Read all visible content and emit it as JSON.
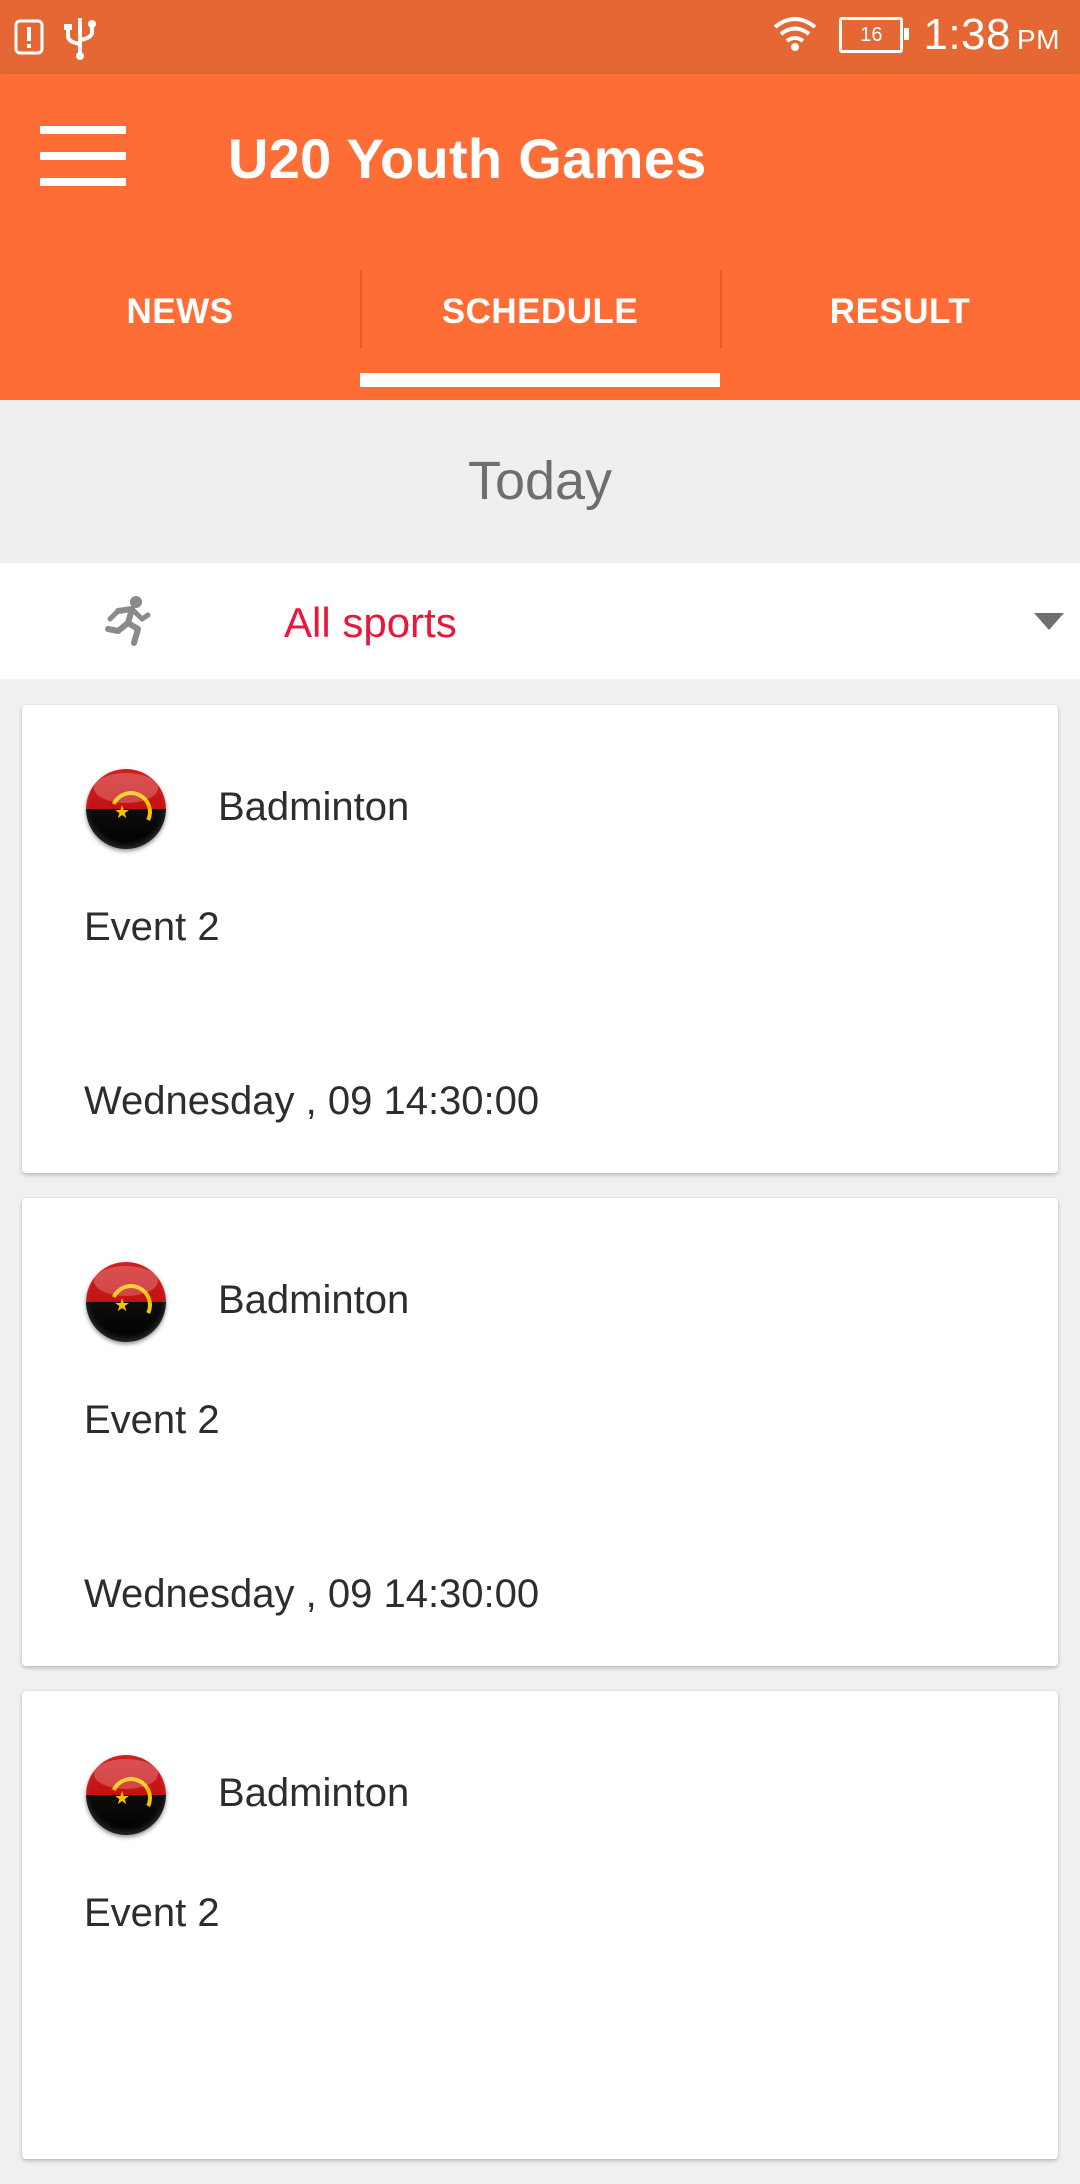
{
  "status_bar": {
    "time": "1:38",
    "ampm": "PM",
    "battery_level": "16",
    "icons": [
      "alert-icon",
      "usb-icon",
      "wifi-icon",
      "battery-icon"
    ]
  },
  "app_bar": {
    "title": "U20 Youth Games",
    "background": "#ff6d36",
    "tabs": [
      {
        "label": "NEWS",
        "active": false
      },
      {
        "label": "SCHEDULE",
        "active": true
      },
      {
        "label": "RESULT",
        "active": false
      }
    ]
  },
  "date_header": "Today",
  "filter": {
    "label": "All sports",
    "color": "#e8173b",
    "icon": "running-icon"
  },
  "schedule": [
    {
      "sport": "Badminton",
      "event": "Event 2",
      "datetime": "Wednesday , 09 14:30:00"
    },
    {
      "sport": "Badminton",
      "event": "Event 2",
      "datetime": "Wednesday , 09 14:30:00"
    },
    {
      "sport": "Badminton",
      "event": "Event 2",
      "datetime": ""
    }
  ]
}
